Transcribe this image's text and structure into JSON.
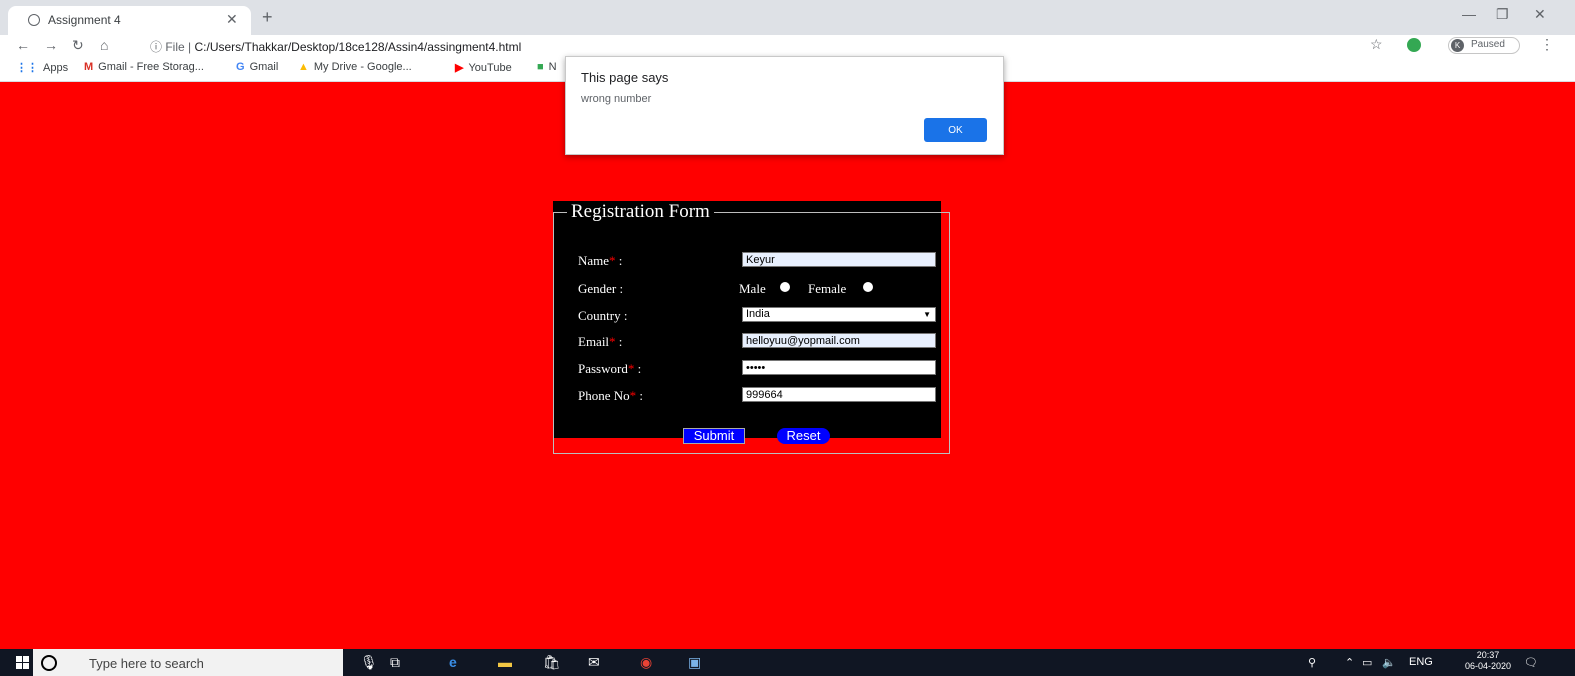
{
  "browser": {
    "tab_title": "Assignment 4",
    "url_prefix": "File",
    "url_path": "C:/Users/Thakkar/Desktop/18ce128/Assin4/assingment4.html",
    "profile_initial": "K",
    "profile_status": "Paused"
  },
  "bookmarks": [
    {
      "label": "Apps",
      "icon": "apps-grid-icon"
    },
    {
      "label": "Gmail - Free Storag...",
      "icon": "gmail-icon"
    },
    {
      "label": "Gmail",
      "icon": "google-g-icon"
    },
    {
      "label": "My Drive - Google...",
      "icon": "drive-icon"
    },
    {
      "label": "YouTube",
      "icon": "youtube-icon"
    },
    {
      "label": "N",
      "icon": "bookmark-icon"
    }
  ],
  "dialog": {
    "title": "This page says",
    "message": "wrong number",
    "ok_label": "OK"
  },
  "form": {
    "legend": "Registration Form",
    "labels": {
      "name": "Name",
      "gender": "Gender :",
      "country": "Country :",
      "email": "Email",
      "password": "Password",
      "phone": "Phone No"
    },
    "required_mark": "*",
    "label_suffix": " :",
    "values": {
      "name": "Keyur",
      "country": "India",
      "email": "helloyuu@yopmail.com",
      "password": "•••••",
      "phone": "999664"
    },
    "gender_options": [
      "Male",
      "Female"
    ],
    "submit_label": "Submit",
    "reset_label": "Reset",
    "colors": {
      "page_background": "#ff0000",
      "form_background": "#000000",
      "button": "#0000ff"
    }
  },
  "taskbar": {
    "search_placeholder": "Type here to search",
    "language": "ENG",
    "time": "20:37",
    "date": "06-04-2020"
  }
}
